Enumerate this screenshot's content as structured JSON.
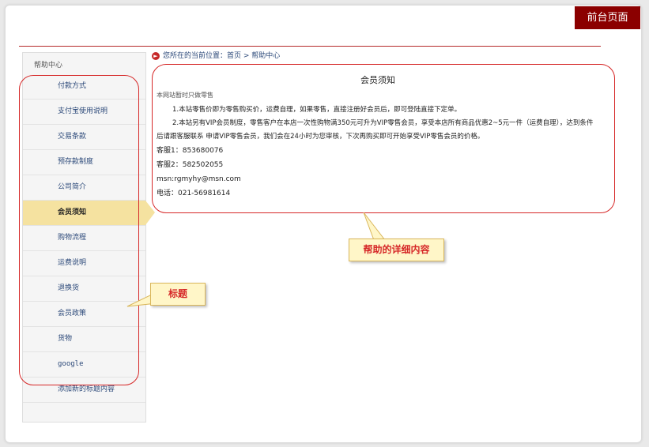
{
  "header": {
    "front_page_button": "前台页面"
  },
  "sidebar": {
    "title": "帮助中心",
    "items": [
      {
        "label": "付款方式"
      },
      {
        "label": "支付宝使用说明"
      },
      {
        "label": "交易条款"
      },
      {
        "label": "预存款制度"
      },
      {
        "label": "公司简介"
      },
      {
        "label": "会员须知",
        "active": true
      },
      {
        "label": "购物流程"
      },
      {
        "label": "运费说明"
      },
      {
        "label": "退换货"
      },
      {
        "label": "会员政策"
      },
      {
        "label": "货物"
      },
      {
        "label": "google"
      },
      {
        "label": "添加新的标题内容"
      }
    ]
  },
  "breadcrumb": {
    "prefix": "您所在的当前位置：",
    "home": "首页",
    "separator": " > ",
    "current": "帮助中心"
  },
  "content": {
    "title": "会员须知",
    "subtitle": "本网站暂时只做零售",
    "para1": "1.本站零售价即为零售购买价，运费自理，如果零售，直接注册好会员后，即可登陆直接下定单。",
    "para2": "2.本站另有VIP会员制度，零售客户在本店一次性购物满350元可升为VIP零售会员，享受本店所有商品优惠2~5元一件（运费自理），达到条件后请跟客服联系  申请VIP零售会员，我们会在24小时为您审核，下次再购买即可开始享受VIP零售会员的价格。",
    "contacts": [
      "客服1：853680076",
      "客服2：582502055",
      "msn:rgmyhy@msn.com",
      "电话：021-56981614"
    ]
  },
  "annotations": {
    "detail": "帮助的详细内容",
    "title": "标题"
  },
  "colors": {
    "brand_red": "#8b0000",
    "annotation_red": "#d62828",
    "active_item": "#f5e2a0"
  }
}
